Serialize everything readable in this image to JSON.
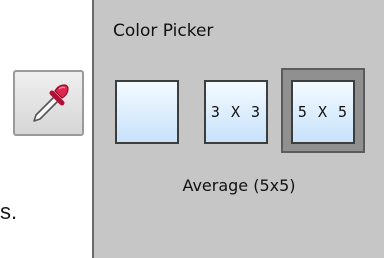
{
  "document": {
    "text_fragment": "s."
  },
  "toolbar": {
    "dropper_icon": "eyedropper-icon"
  },
  "color_picker": {
    "title": "Color Picker",
    "sample_options": [
      {
        "label": ""
      },
      {
        "label": "3 X 3"
      },
      {
        "label": "5 X 5"
      }
    ],
    "selected_index": 2,
    "status": "Average (5x5)"
  },
  "colors": {
    "panel_bg": "#c6c6c6",
    "swatch_top": "#f4faff",
    "swatch_bottom": "#c7e2fb",
    "dropper_tip": "#d81b45"
  }
}
